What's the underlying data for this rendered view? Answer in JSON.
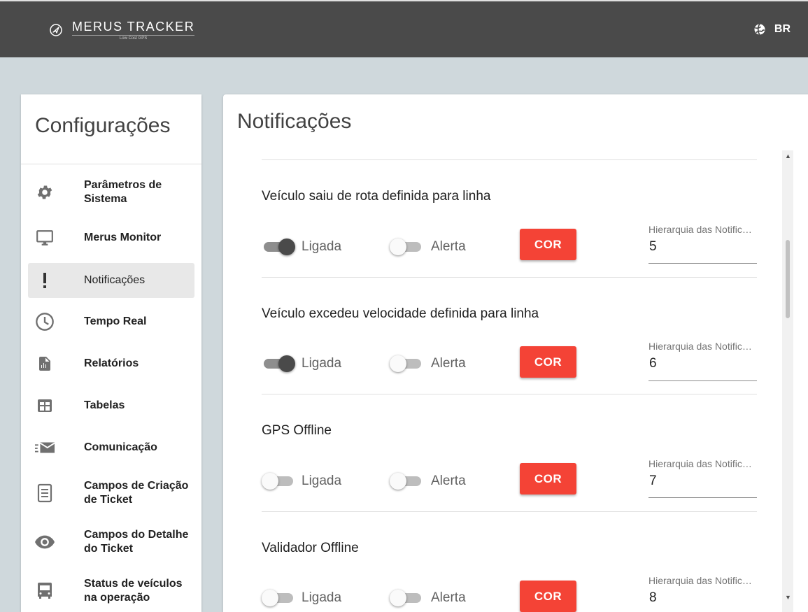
{
  "header": {
    "brand": "MERUS TRACKER",
    "brand_sub": "Low Cost GPS",
    "language": "BR"
  },
  "sidebar": {
    "title": "Configurações",
    "items": [
      {
        "label": "Parâmetros de Sistema",
        "icon": "gear-icon"
      },
      {
        "label": "Merus Monitor",
        "icon": "monitor-icon"
      },
      {
        "label": "Notificações",
        "icon": "exclamation-icon",
        "active": true
      },
      {
        "label": "Tempo Real",
        "icon": "clock-icon"
      },
      {
        "label": "Relatórios",
        "icon": "report-icon"
      },
      {
        "label": "Tabelas",
        "icon": "table-icon"
      },
      {
        "label": "Comunicação",
        "icon": "email-fast-icon"
      },
      {
        "label": "Campos de Criação de Ticket",
        "icon": "form-icon"
      },
      {
        "label": "Campos do Detalhe do Ticket",
        "icon": "eye-icon"
      },
      {
        "label": "Status de veículos na operação",
        "icon": "bus-icon"
      }
    ]
  },
  "main": {
    "title": "Notificações",
    "notifications": [
      {
        "title": "Veículo saiu de rota definida para linha",
        "enabled_label": "Ligada",
        "enabled": true,
        "alert_label": "Alerta",
        "alert": false,
        "color_button": "COR",
        "hierarchy_label": "Hierarquia das Notificações",
        "hierarchy_value": "5"
      },
      {
        "title": "Veículo excedeu velocidade definida para linha",
        "enabled_label": "Ligada",
        "enabled": true,
        "alert_label": "Alerta",
        "alert": false,
        "color_button": "COR",
        "hierarchy_label": "Hierarquia das Notificações",
        "hierarchy_value": "6"
      },
      {
        "title": "GPS Offline",
        "enabled_label": "Ligada",
        "enabled": false,
        "alert_label": "Alerta",
        "alert": false,
        "color_button": "COR",
        "hierarchy_label": "Hierarquia das Notificações",
        "hierarchy_value": "7"
      },
      {
        "title": "Validador Offline",
        "enabled_label": "Ligada",
        "enabled": false,
        "alert_label": "Alerta",
        "alert": false,
        "color_button": "COR",
        "hierarchy_label": "Hierarquia das Notificações",
        "hierarchy_value": "8"
      }
    ]
  },
  "colors": {
    "header_bg": "#4a4a4a",
    "page_bg": "#cfd8dc",
    "button": "#f44336"
  }
}
